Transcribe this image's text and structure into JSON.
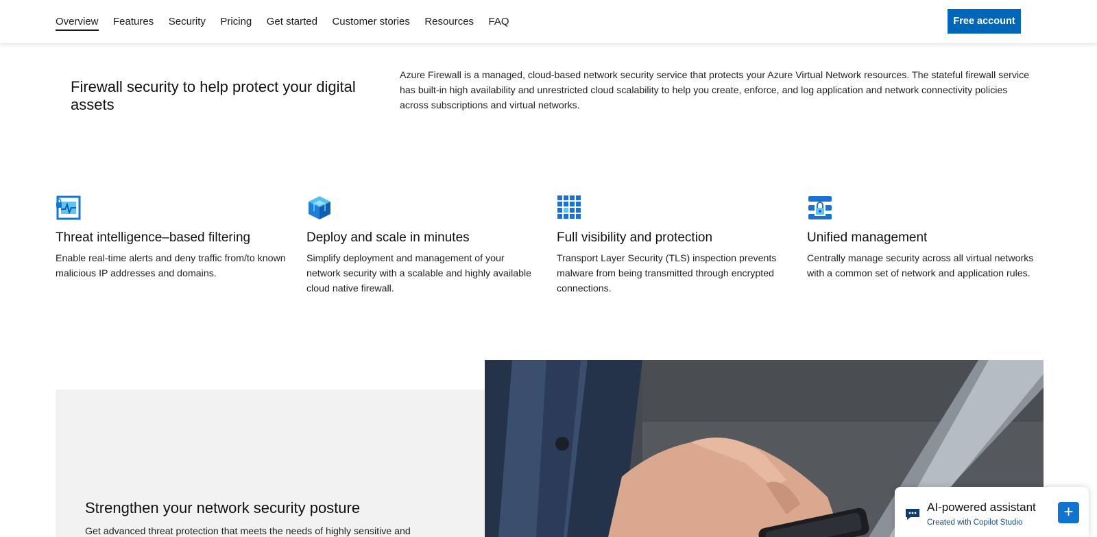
{
  "nav": {
    "items": [
      {
        "label": "Overview",
        "active": true
      },
      {
        "label": "Features"
      },
      {
        "label": "Security"
      },
      {
        "label": "Pricing"
      },
      {
        "label": "Get started"
      },
      {
        "label": "Customer stories"
      },
      {
        "label": "Resources"
      },
      {
        "label": "FAQ"
      }
    ],
    "cta_label": "Free account"
  },
  "intro": {
    "title": "Firewall security to help protect your digital assets",
    "description": "Azure Firewall is a managed, cloud-based network security service that protects your Azure Virtual Network resources. The stateful firewall service has built-in high availability and unrestricted cloud scalability to help you create, enforce, and log application and network connectivity policies across subscriptions and virtual networks."
  },
  "features": [
    {
      "icon": "threat-intelligence-icon",
      "title": "Threat intelligence–based filtering",
      "text": "Enable real-time alerts and deny traffic from/to known malicious IP addresses and domains."
    },
    {
      "icon": "cube-icon",
      "title": "Deploy and scale in minutes",
      "text": "Simplify deployment and management of your network security with a scalable and highly available cloud native firewall."
    },
    {
      "icon": "grid-icon",
      "title": "Full visibility and protection",
      "text": "Transport Layer Security (TLS) inspection prevents malware from being transmitted through encrypted connections."
    },
    {
      "icon": "lock-server-icon",
      "title": "Unified management",
      "text": "Centrally manage security across all virtual networks with a common set of network and application rules."
    }
  ],
  "posture": {
    "title": "Strengthen your network security posture",
    "description": "Get advanced threat protection that meets the needs of highly sensitive and"
  },
  "assistant": {
    "title": "AI-powered assistant",
    "subtitle": "Created with Copilot Studio",
    "plus": "+"
  },
  "colors": {
    "accent": "#0067b8",
    "icon_blue": "#1e88e5",
    "panel_grey": "#f2f2f2"
  }
}
